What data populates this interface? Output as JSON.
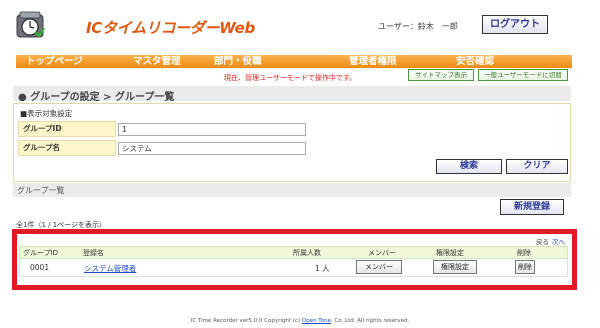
{
  "header": {
    "app_title": "ICタイムリコーダーWeb",
    "user_label": "ユーザー：鈴木　一郎",
    "logout_label": "ログアウト"
  },
  "nav": {
    "items": [
      "トップページ",
      "マスタ管理",
      "部門・役職",
      "管理者権限",
      "安否確認"
    ]
  },
  "mode": {
    "note": "現在、管理ユーザーモードで操作中です。",
    "sitemap_label": "サイトマップ表示",
    "switch_label": "一般ユーザーモードに切替"
  },
  "section": {
    "title": "● グループの設定 > グループ一覧"
  },
  "target": {
    "caption": "■表示対象設定",
    "group_id_label": "グループID",
    "group_id_value": "1",
    "group_name_label": "グループ名",
    "group_name_value": "システム",
    "search_label": "検索",
    "clear_label": "クリア"
  },
  "list": {
    "header": "グループ一覧",
    "new_label": "新規登録",
    "count_text": "全1件（1 / 1ページを表示）",
    "pager_prev": "戻る",
    "pager_next": "次へ",
    "columns": [
      "グループID",
      "登録名",
      "所属人数",
      "メンバー",
      "権限設定",
      "削除"
    ],
    "rows": [
      {
        "id": "0001",
        "name": "システム管理者",
        "members": "1 人",
        "member_btn": "メンバー",
        "perm_btn": "権限設定",
        "delete_btn": "削除"
      }
    ]
  },
  "footer": {
    "prefix": "IC Time Recorder ver5.0.0 Copyright (c)",
    "company": "Open Tone",
    "suffix": ", Co.,Ltd. All rights reserved."
  },
  "colors": {
    "brand_orange": "#e0580d",
    "nav_orange": "#ee8a14",
    "highlight_red": "#e01b24",
    "link_blue": "#1a4fbf"
  }
}
